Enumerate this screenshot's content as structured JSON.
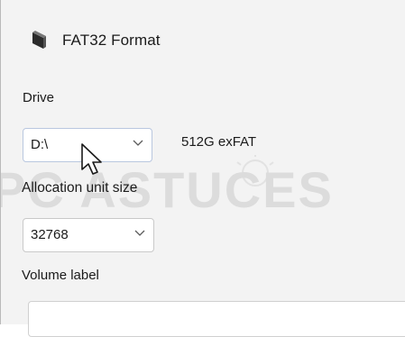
{
  "window": {
    "title": "FAT32 Format",
    "icon": "app-icon"
  },
  "drive": {
    "label": "Drive",
    "selected": "D:\\",
    "info": "512G exFAT"
  },
  "allocation": {
    "label": "Allocation unit size",
    "selected": "32768"
  },
  "volume": {
    "label": "Volume label",
    "value": ""
  },
  "watermark": {
    "text": "PC ASTUCES",
    "color": "#d9d9d9"
  }
}
